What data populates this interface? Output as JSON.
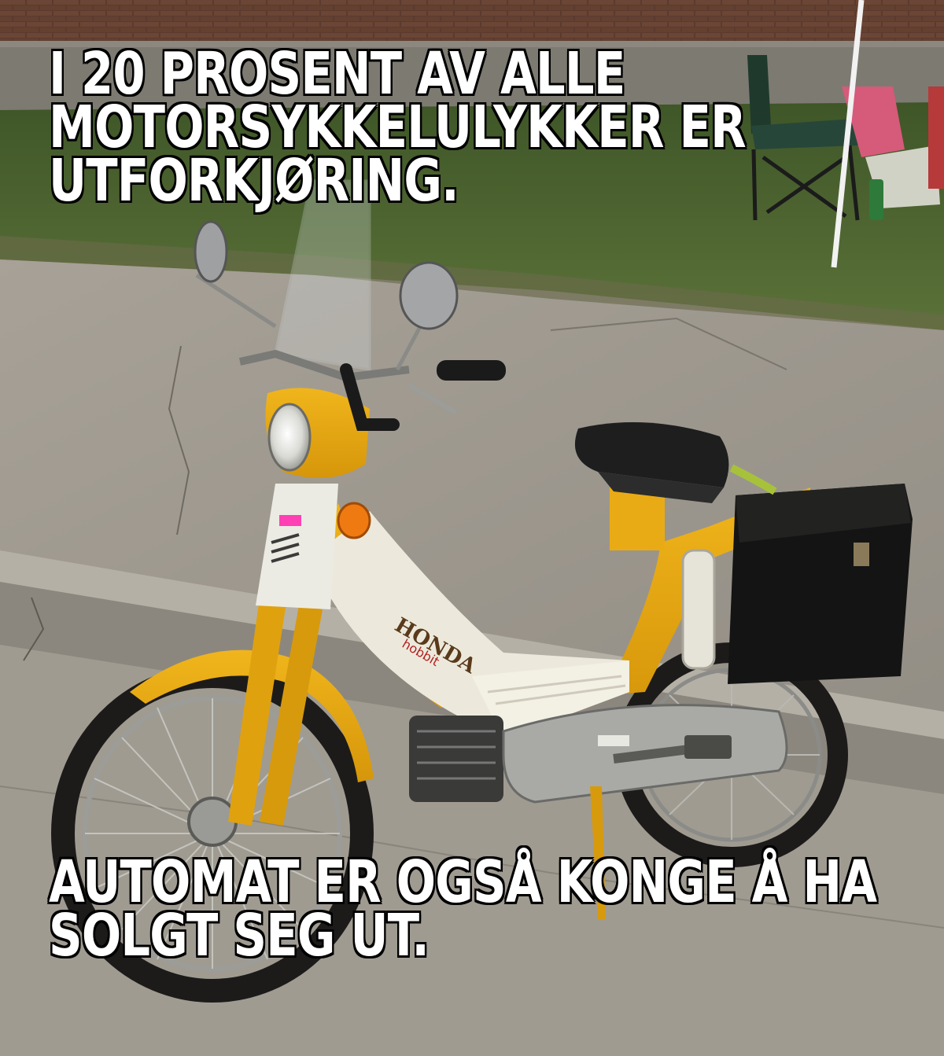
{
  "meme": {
    "top_text": [
      "I 20 PROSENT AV ALLE",
      "MOTORSYKKELULYKKER ER",
      "UTFORKJØRING."
    ],
    "bottom_text": [
      "AUTOMAT ER OGSÅ KONGE Å HA",
      "SOLGT SEG UT."
    ]
  },
  "scene": {
    "subject": "yellow-honda-moped",
    "brand_marks": [
      "HONDA",
      "hobbit"
    ],
    "colors": {
      "body_yellow": "#e7a812",
      "panel_white": "#ece9dc",
      "pavement": "#9b968d",
      "grass": "#4f6a32",
      "brick": "#5a3a2e",
      "tyre": "#1c1b1a",
      "seat": "#1e1e1e",
      "caption_fill": "#ffffff",
      "caption_outline": "#000000"
    }
  }
}
